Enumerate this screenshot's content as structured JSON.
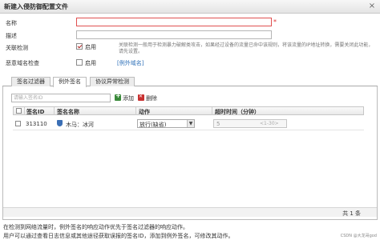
{
  "window": {
    "title": "新建入侵防御配置文件",
    "close_glyph": "×"
  },
  "form": {
    "name_label": "名称",
    "desc_label": "描述",
    "related_label": "关联检测",
    "enable_label": "启用",
    "related_note": "关联检测一般用于检测暴力破解类攻击，如果经过设备的流量已命中该规则，将该流量的IP地址转换，需要关闭此功能，请先设置。",
    "malicious_label": "恶意域名检查",
    "malicious_enable_label": "启用",
    "malicious_link": "[例外域名]"
  },
  "tabs": [
    {
      "label": "签名过滤器"
    },
    {
      "label": "例外签名"
    },
    {
      "label": "协议异常检测"
    }
  ],
  "toolbar": {
    "search_placeholder": "请输入签名ID",
    "add_label": "添加",
    "delete_label": "删除"
  },
  "table": {
    "headers": [
      "签名ID",
      "签名名称",
      "动作",
      "超时时间（分钟）"
    ],
    "rows": [
      {
        "id": "313110",
        "name": "木马：冰河",
        "action": "放行(缺省)",
        "timeout": "5",
        "range": "<1-30>"
      }
    ]
  },
  "footer": {
    "count": "共 1 条"
  },
  "notes": [
    "在检测到网络流量时，例外签名的响应动作优先于签名过滤器的响应动作。",
    "用户可以通过查看日志信息或其他途径获取误报的签名ID，添加到例外签名，可修改其动作。"
  ],
  "watermark": "CSDN @大龙哥god"
}
